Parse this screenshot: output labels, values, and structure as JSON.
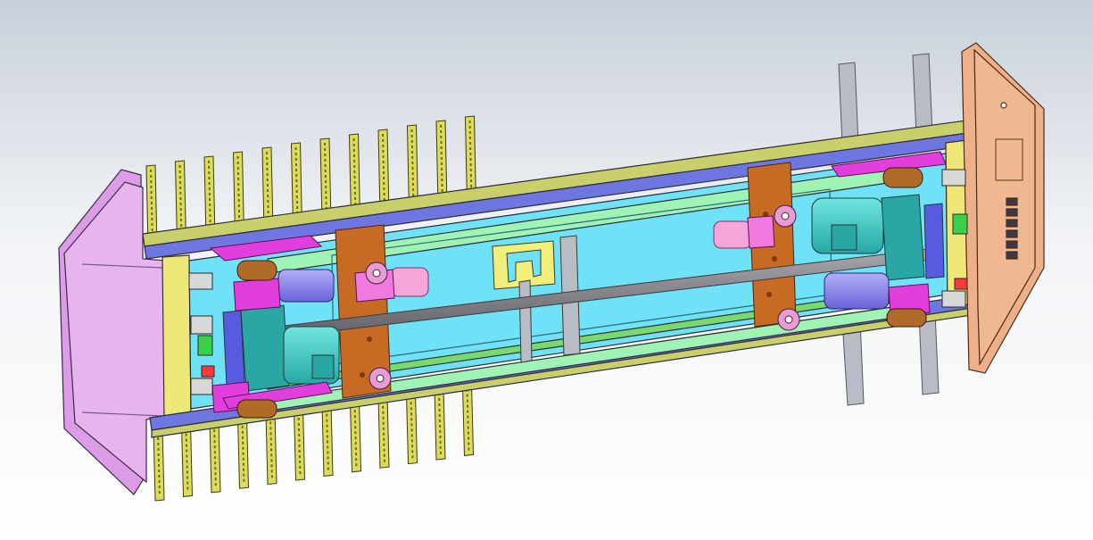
{
  "colors": {
    "background_top": "#c9d0da",
    "background_mid": "#f2f4f7",
    "background_bottom": "#ffffff",
    "end_cap_left": "#e4a8ee",
    "end_cap_right": "#eeb088",
    "frame_rail": "#6e76e0",
    "side_rail": "#c9cf6a",
    "inner_bed": "#6fe2f8",
    "guide_rail": "#9ff3b4",
    "slider_block": "#c66a24",
    "motor_body": "#3fc8c2",
    "motor_cap": "#8e88ee",
    "bracket_magenta": "#e23ede",
    "rack_teeth": "#dcdc5a",
    "post_gray": "#b8bcc4",
    "shaft_gray": "#7c7c82",
    "wheel_pink": "#f4a6d8",
    "yellow_fork": "#f1ee7a"
  },
  "icons": [
    "gear-motor-icon",
    "roller-wheel-icon",
    "rack-tooth-icon"
  ]
}
